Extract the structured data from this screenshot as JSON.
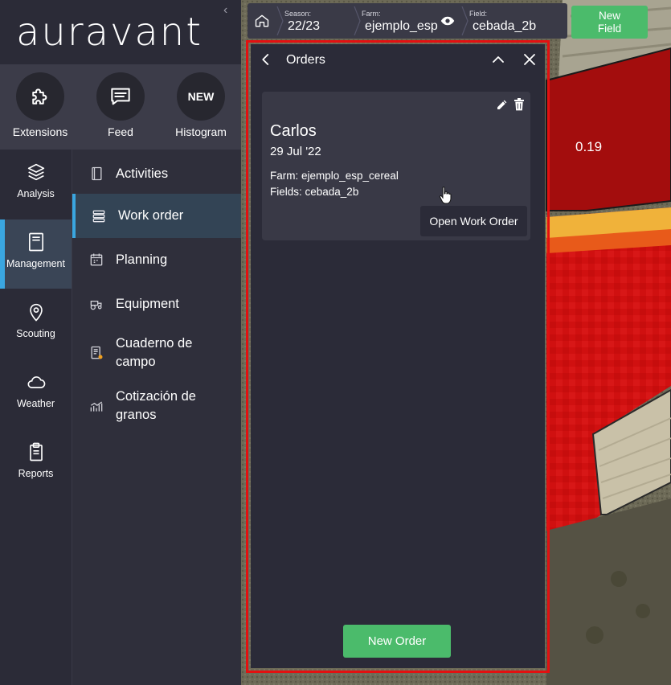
{
  "app": {
    "logo": "auravant",
    "collapse_glyph": "‹"
  },
  "quick_actions": [
    {
      "label": "Extensions",
      "icon": "puzzle-icon"
    },
    {
      "label": "Feed",
      "icon": "message-icon"
    },
    {
      "label": "Histogram",
      "icon": "new-badge",
      "badge": "NEW"
    }
  ],
  "nav": [
    {
      "label": "Analysis",
      "icon": "layers-icon",
      "active": false
    },
    {
      "label": "Management",
      "icon": "notebook-icon",
      "active": true
    },
    {
      "label": "Scouting",
      "icon": "map-pin-icon",
      "active": false
    },
    {
      "label": "Weather",
      "icon": "cloud-icon",
      "active": false
    },
    {
      "label": "Reports",
      "icon": "clipboard-icon",
      "active": false
    }
  ],
  "submenu": [
    {
      "label": "Activities",
      "icon": "book-icon",
      "active": false
    },
    {
      "label": "Work order",
      "icon": "server-stack-icon",
      "active": true
    },
    {
      "label": "Planning",
      "icon": "calendar-icon",
      "active": false
    },
    {
      "label": "Equipment",
      "icon": "tractor-icon",
      "active": false
    },
    {
      "label": "Cuaderno de campo",
      "icon": "document-icon",
      "active": false
    },
    {
      "label": "Cotización de granos",
      "icon": "chart-icon",
      "active": false
    }
  ],
  "topbar": {
    "season_label": "Season:",
    "season_value": "22/23",
    "farm_label": "Farm:",
    "farm_value": "ejemplo_esp",
    "field_label": "Field:",
    "field_value": "cebada_2b",
    "new_field_line1": "New",
    "new_field_line2": "Field"
  },
  "orders": {
    "title": "Orders",
    "card": {
      "name": "Carlos",
      "date": "29 Jul '22",
      "farm": "Farm: ejemplo_esp_cereal",
      "fields": "Fields: cebada_2b",
      "open_button": "Open Work Order"
    },
    "new_order_button": "New Order"
  },
  "map": {
    "value_label": "0.19"
  },
  "colors": {
    "accent_blue": "#3aa6e0",
    "green_button": "#4bbb6b",
    "highlight_red": "#e31010"
  }
}
